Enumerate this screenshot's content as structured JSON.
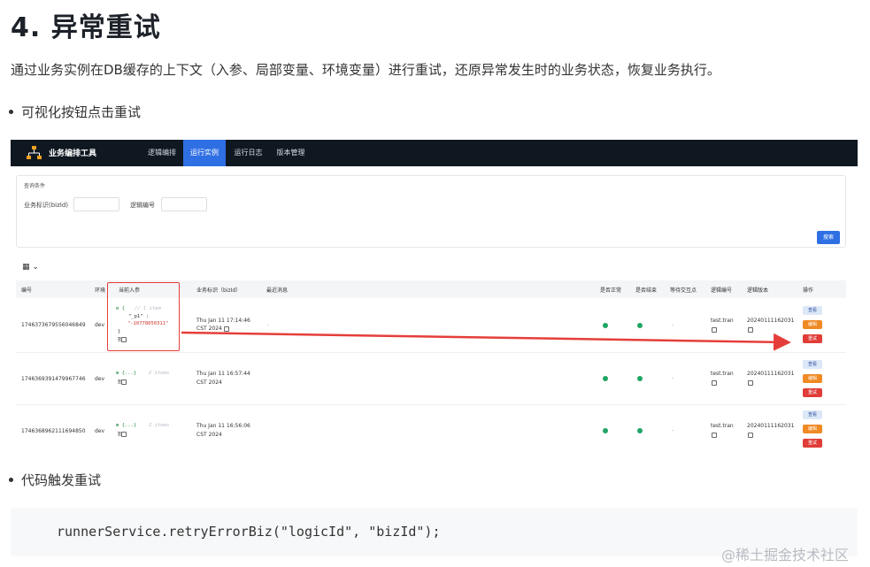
{
  "heading": "4. 异常重试",
  "intro": "通过业务实例在DB缓存的上下文（入参、局部变量、环境变量）进行重试，还原异常发生时的业务状态，恢复业务执行。",
  "bullet1": "可视化按钮点击重试",
  "bullet2": "代码触发重试",
  "app": {
    "title": "业务编排工具",
    "nav": [
      "逻辑编排",
      "运行实例",
      "运行日志",
      "版本管理"
    ],
    "active_nav": "运行实例",
    "query": {
      "title": "查询条件",
      "biz_label": "业务标识(bizId)",
      "logic_label": "逻辑编号",
      "search": "搜索"
    },
    "columns": [
      "编号",
      "环境",
      "当前入参",
      "业务标识（bizId）",
      "最近消息",
      "是否正常",
      "是否结束",
      "等待交互点",
      "逻辑编号",
      "逻辑版本",
      "操作"
    ],
    "rows": [
      {
        "id": "1746373679556046849",
        "env": "dev",
        "param_open": "⊟ {",
        "param_comment": "// 1 item",
        "param_key": "\"_p1\" :",
        "param_value": "\"-10778050311\"",
        "param_close": "}",
        "time1": "Thu Jan 11 17:14:46",
        "time2": "CST 2024",
        "waiting": "-",
        "logic_id": "test.tran",
        "logic_version": "20240111162031"
      },
      {
        "id": "1746369391479967746",
        "env": "dev",
        "param_open": "⊞ {...}",
        "param_comment": "2 items",
        "time1": "Thu Jan 11 16:57:44",
        "time2": "CST 2024",
        "waiting": "-",
        "logic_id": "test.tran",
        "logic_version": "20240111162031"
      },
      {
        "id": "1746368962111694850",
        "env": "dev",
        "param_open": "⊞ {...}",
        "param_comment": "2 items",
        "time1": "Thu Jan 11 16:56:06",
        "time2": "CST 2024",
        "waiting": "-",
        "logic_id": "test.tran",
        "logic_version": "20240111162031"
      }
    ],
    "buttons": {
      "view": "查看",
      "edit": "编辑",
      "retry": "重试"
    }
  },
  "code": "runnerService.retryErrorBiz(\"logicId\", \"bizId\");",
  "watermark": "@稀土掘金技术社区",
  "colors": {
    "nav_bg": "#0f1821",
    "accent": "#2f6fe4",
    "ok": "#21a565",
    "edit": "#f08a25",
    "retry": "#e03c38",
    "annotation": "#e53e3a"
  }
}
